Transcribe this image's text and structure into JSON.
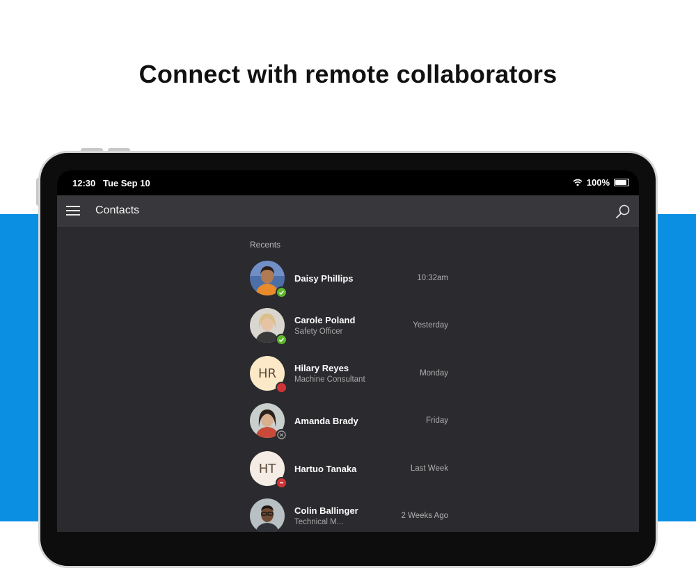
{
  "headline": "Connect with remote collaborators",
  "status_bar": {
    "time": "12:30",
    "date": "Tue Sep 10",
    "battery": "100%"
  },
  "appbar": {
    "title": "Contacts"
  },
  "recents": {
    "label": "Recents",
    "contacts": [
      {
        "name": "Daisy Phillips",
        "subtitle": "",
        "when": "10:32am",
        "initials": "",
        "presence": "available"
      },
      {
        "name": "Carole Poland",
        "subtitle": "Safety Officer",
        "when": "Yesterday",
        "initials": "",
        "presence": "available"
      },
      {
        "name": "Hilary Reyes",
        "subtitle": "Machine Consultant",
        "when": "Monday",
        "initials": "HR",
        "presence": "busy"
      },
      {
        "name": "Amanda Brady",
        "subtitle": "",
        "when": "Friday",
        "initials": "",
        "presence": "offline"
      },
      {
        "name": "Hartuo Tanaka",
        "subtitle": "",
        "when": "Last Week",
        "initials": "HT",
        "presence": "do-not-disturb"
      },
      {
        "name": "Colin Ballinger",
        "subtitle": "Technical M...",
        "when": "2 Weeks Ago",
        "initials": "",
        "presence": ""
      }
    ]
  },
  "colors": {
    "accent_blue": "#0a8fe3",
    "available": "#5cb82b",
    "busy": "#d13438",
    "offline": "#8a8a8a"
  }
}
